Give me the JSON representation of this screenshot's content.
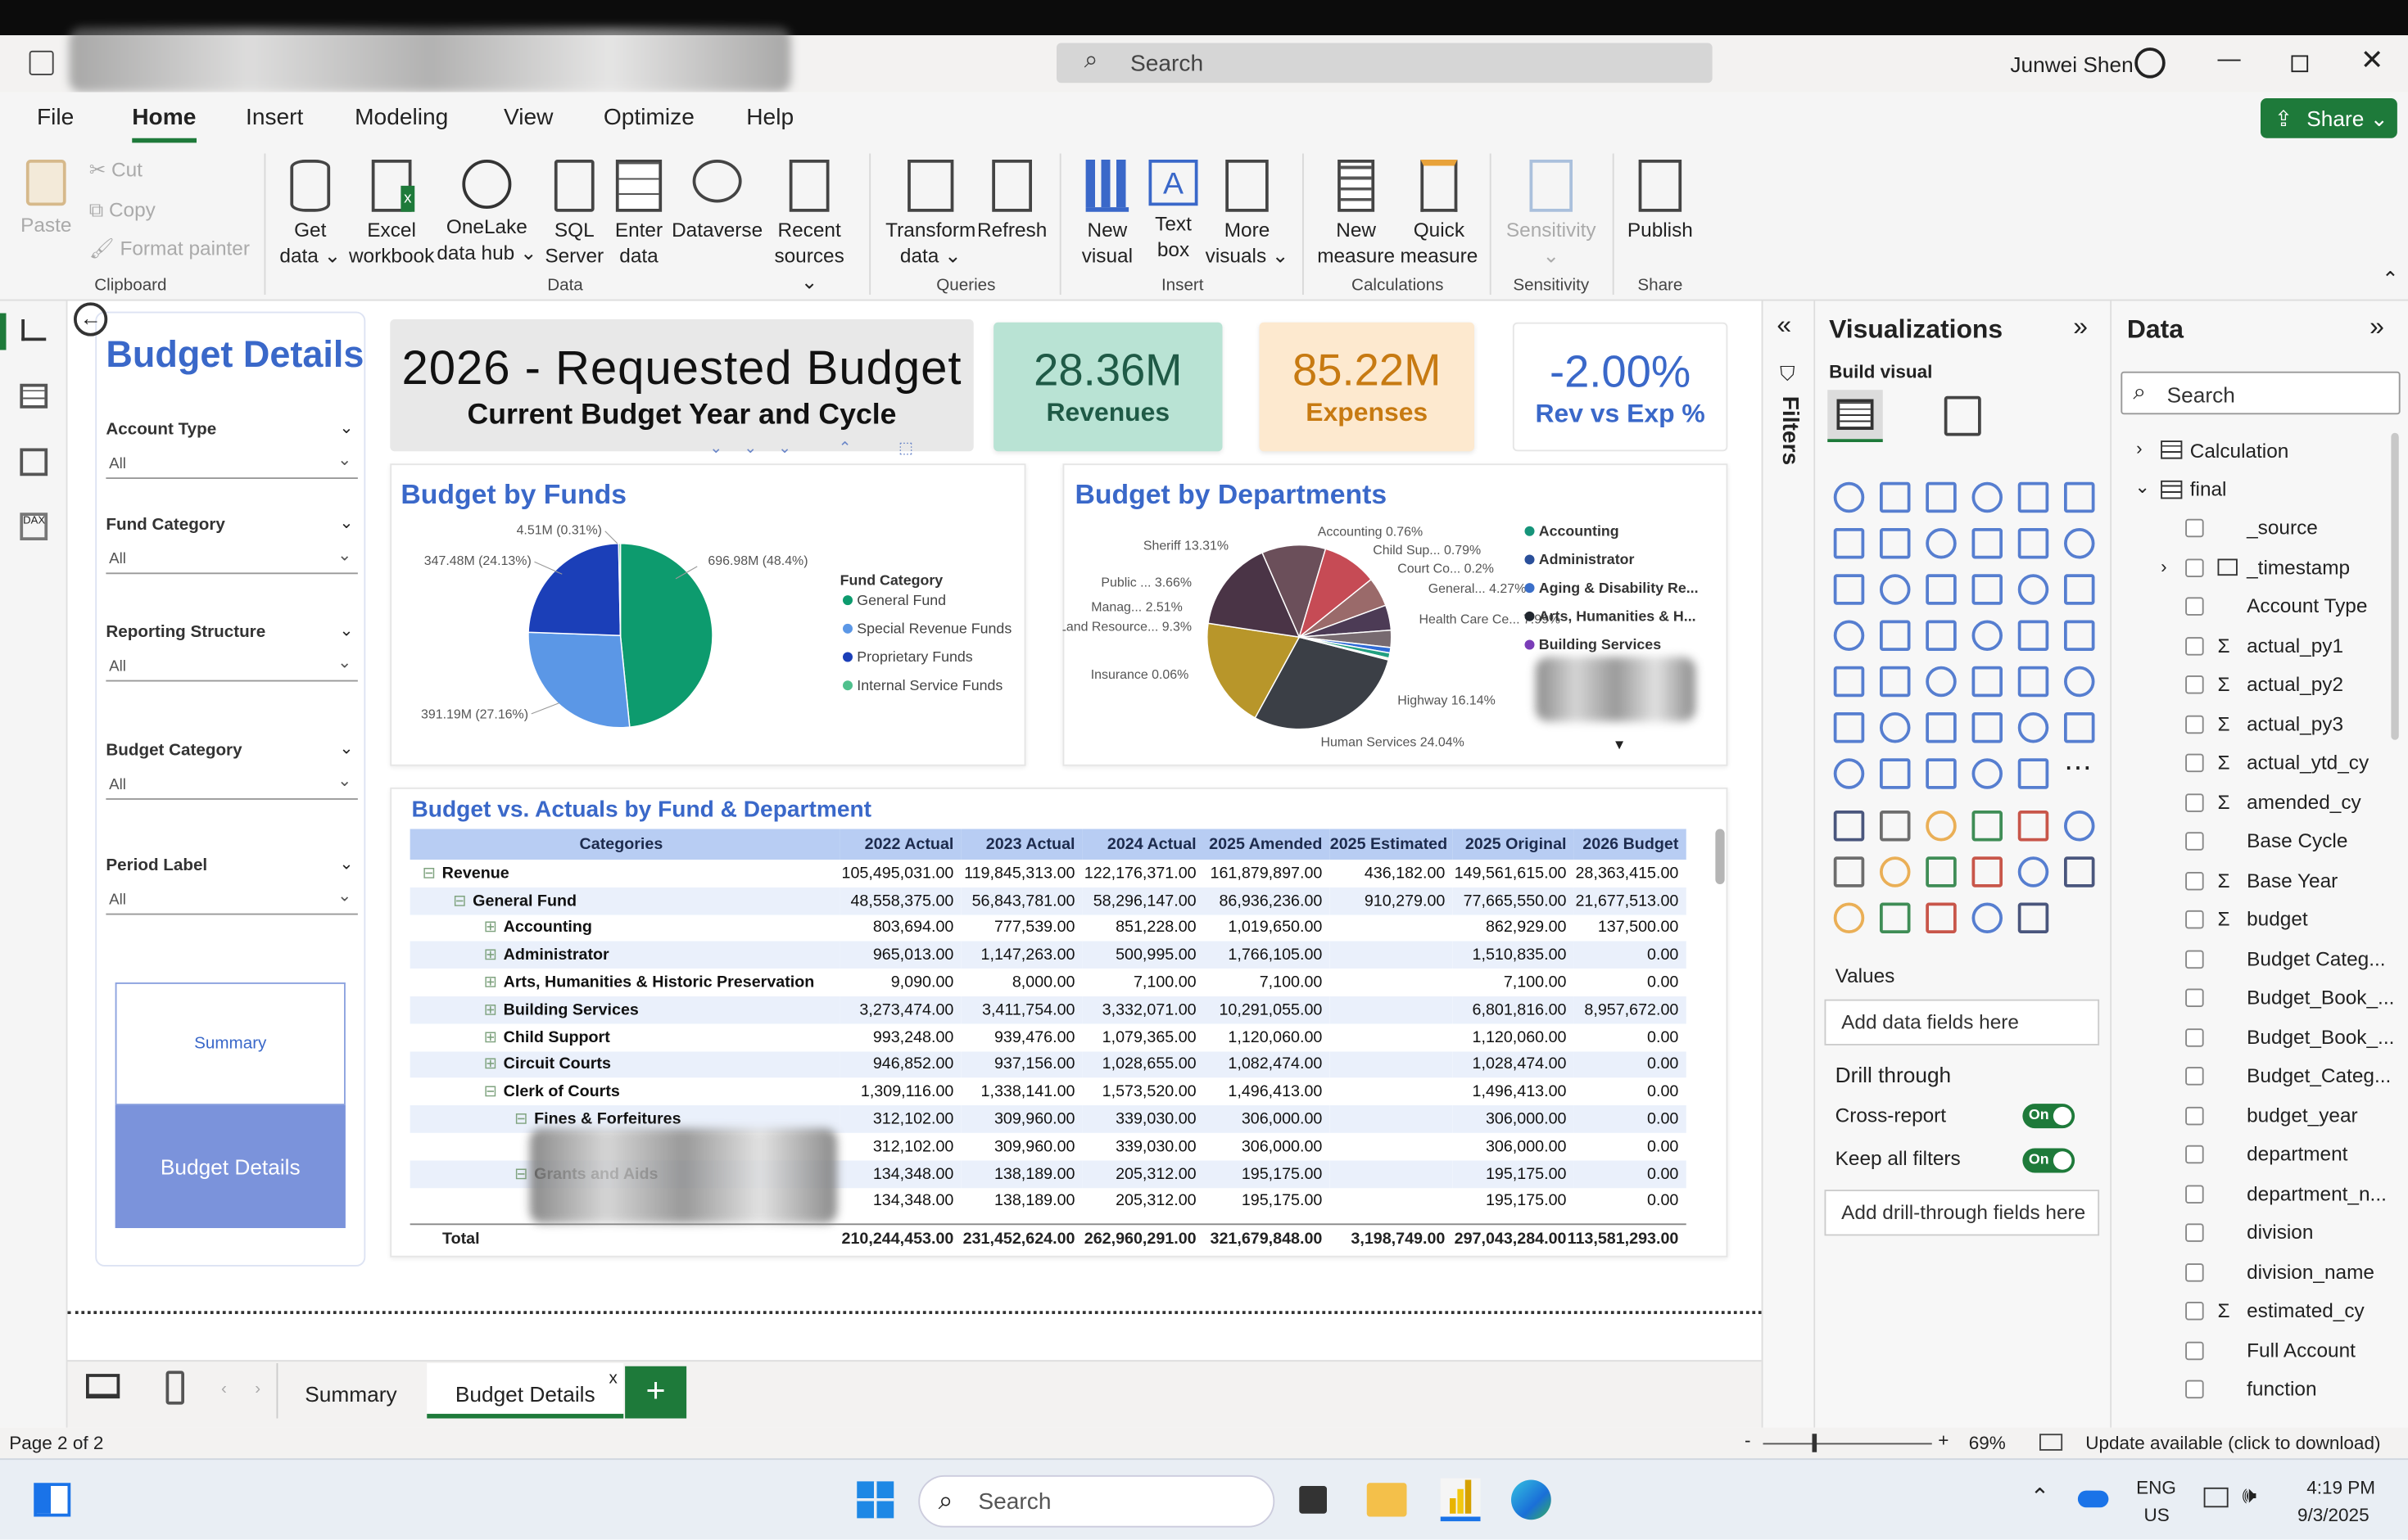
{
  "window": {
    "search_placeholder": "Search",
    "user_name": "Junwei Shen"
  },
  "menu": {
    "file": "File",
    "home": "Home",
    "insert": "Insert",
    "modeling": "Modeling",
    "view": "View",
    "optimize": "Optimize",
    "help": "Help",
    "share": "Share"
  },
  "ribbon": {
    "paste": "Paste",
    "cut": "Cut",
    "copy": "Copy",
    "format_painter": "Format painter",
    "clipboard": "Clipboard",
    "get_data_1": "Get",
    "get_data_2": "data ⌄",
    "excel_1": "Excel",
    "excel_2": "workbook",
    "onelake_1": "OneLake",
    "onelake_2": "data hub ⌄",
    "sql_1": "SQL",
    "sql_2": "Server",
    "enter_1": "Enter",
    "enter_2": "data",
    "dataverse": "Dataverse",
    "recent_1": "Recent",
    "recent_2": "sources ⌄",
    "data_group": "Data",
    "transform_1": "Transform",
    "transform_2": "data ⌄",
    "refresh": "Refresh",
    "queries_group": "Queries",
    "newvisual_1": "New",
    "newvisual_2": "visual",
    "textbox_1": "Text",
    "textbox_2": "box",
    "morevisuals_1": "More",
    "morevisuals_2": "visuals ⌄",
    "insert_group": "Insert",
    "newmeasure_1": "New",
    "newmeasure_2": "measure",
    "quickmeasure_1": "Quick",
    "quickmeasure_2": "measure",
    "calc_group": "Calculations",
    "sensitivity": "Sensitivity",
    "sensitivity_group": "Sensitivity",
    "publish": "Publish",
    "share_group": "Share"
  },
  "report": {
    "page_title": "Budget Details",
    "slicers": [
      {
        "label": "Account Type",
        "value": "All"
      },
      {
        "label": "Fund Category",
        "value": "All"
      },
      {
        "label": "Reporting Structure",
        "value": "All"
      },
      {
        "label": "Budget Category",
        "value": "All"
      },
      {
        "label": "Period Label",
        "value": "All"
      }
    ],
    "nav_summary": "Summary",
    "nav_details": "Budget Details",
    "header_title": "2026 - Requested Budget",
    "header_subtitle": "Current Budget Year and Cycle",
    "kpi_revenues_value": "28.36M",
    "kpi_revenues_label": "Revenues",
    "kpi_expenses_value": "85.22M",
    "kpi_expenses_label": "Expenses",
    "kpi_revexp_value": "-2.00%",
    "kpi_revexp_label": "Rev vs Exp %",
    "colors": {
      "title_blue": "#3a68c9",
      "revenue_bg": "#b9e3d4",
      "expense_bg": "#fde9cf",
      "expense_text": "#c77a12",
      "nav_active": "#7b93db"
    }
  },
  "chart_data": [
    {
      "type": "pie",
      "title": "Budget by Funds",
      "legend_title": "Fund Category",
      "labels": [
        "General Fund",
        "Special Revenue Funds",
        "Proprietary Funds",
        "Internal Service Funds"
      ],
      "values": [
        696.98,
        391.19,
        347.48,
        4.51
      ],
      "data_labels": [
        "696.98M (48.4%)",
        "391.19M (27.16%)",
        "347.48M (24.13%)",
        "4.51M (0.31%)"
      ],
      "colors": [
        "#0d9b6e",
        "#5b97e6",
        "#1b3fb8",
        "#4fc08d"
      ]
    },
    {
      "type": "pie",
      "title": "Budget by Departments",
      "legend": [
        "Accounting",
        "Administrator",
        "Aging & Disability Re...",
        "Arts, Humanities & H...",
        "Building Services"
      ],
      "legend_colors": [
        "#16947a",
        "#2a4f9a",
        "#3b6fc9",
        "#20262e",
        "#7a3db8"
      ],
      "data_labels": [
        "Human Services 24.04%",
        "Highway 16.14%",
        "Sheriff 13.31%",
        "Land Resource... 9.3%",
        "Health Care Ce... 7.99%",
        "General... 4.27%",
        "Public ... 3.66%",
        "Manag... 2.51%",
        "Child Sup... 0.79%",
        "Accounting 0.76%",
        "Court Co... 0.2%",
        "Insurance 0.06%"
      ],
      "labels": [
        "Human Services",
        "Highway",
        "Sheriff",
        "Land Resource...",
        "Health Care Ce...",
        "General...",
        "Public ...",
        "Manag...",
        "Child Sup...",
        "Accounting",
        "Court Co...",
        "Insurance"
      ],
      "values": [
        24.04,
        16.14,
        13.31,
        9.3,
        7.99,
        4.27,
        3.66,
        2.51,
        0.79,
        0.76,
        0.2,
        0.06
      ],
      "colors": [
        "#3b3f46",
        "#b8962a",
        "#4a3446",
        "#6b4f5a",
        "#c64b55",
        "#9a6a6a",
        "#4c3b55",
        "#776a70",
        "#2f6bd6",
        "#22a080",
        "#f2a33b",
        "#9bb6d8"
      ]
    }
  ],
  "matrix": {
    "title": "Budget vs. Actuals by Fund & Department",
    "headers": [
      "Categories",
      "2022 Actual",
      "2023 Actual",
      "2024 Actual",
      "2025 Amended",
      "2025 Estimated",
      "2025 Original",
      "2026 Budget"
    ],
    "rows": [
      {
        "label": "Revenue",
        "level": 0,
        "icon": "⊟",
        "vals": [
          "105,495,031.00",
          "119,845,313.00",
          "122,176,371.00",
          "161,879,897.00",
          "436,182.00",
          "149,561,615.00",
          "28,363,415.00"
        ]
      },
      {
        "label": "General Fund",
        "level": 1,
        "icon": "⊟",
        "vals": [
          "48,558,375.00",
          "56,843,781.00",
          "58,296,147.00",
          "86,936,236.00",
          "910,279.00",
          "77,665,550.00",
          "21,677,513.00"
        ]
      },
      {
        "label": "Accounting",
        "level": 2,
        "icon": "⊞",
        "vals": [
          "803,694.00",
          "777,539.00",
          "851,228.00",
          "1,019,650.00",
          "",
          "862,929.00",
          "137,500.00"
        ]
      },
      {
        "label": "Administrator",
        "level": 2,
        "icon": "⊞",
        "vals": [
          "965,013.00",
          "1,147,263.00",
          "500,995.00",
          "1,766,105.00",
          "",
          "1,510,835.00",
          "0.00"
        ]
      },
      {
        "label": "Arts, Humanities & Historic Preservation",
        "level": 2,
        "icon": "⊞",
        "vals": [
          "9,090.00",
          "8,000.00",
          "7,100.00",
          "7,100.00",
          "",
          "7,100.00",
          "0.00"
        ]
      },
      {
        "label": "Building Services",
        "level": 2,
        "icon": "⊞",
        "vals": [
          "3,273,474.00",
          "3,411,754.00",
          "3,332,071.00",
          "10,291,055.00",
          "",
          "6,801,816.00",
          "8,957,672.00"
        ]
      },
      {
        "label": "Child Support",
        "level": 2,
        "icon": "⊞",
        "vals": [
          "993,248.00",
          "939,476.00",
          "1,079,365.00",
          "1,120,060.00",
          "",
          "1,120,060.00",
          "0.00"
        ]
      },
      {
        "label": "Circuit Courts",
        "level": 2,
        "icon": "⊞",
        "vals": [
          "946,852.00",
          "937,156.00",
          "1,028,655.00",
          "1,082,474.00",
          "",
          "1,028,474.00",
          "0.00"
        ]
      },
      {
        "label": "Clerk of Courts",
        "level": 2,
        "icon": "⊟",
        "vals": [
          "1,309,116.00",
          "1,338,141.00",
          "1,573,520.00",
          "1,496,413.00",
          "",
          "1,496,413.00",
          "0.00"
        ]
      },
      {
        "label": "Fines & Forfeitures",
        "level": 3,
        "icon": "⊟",
        "vals": [
          "312,102.00",
          "309,960.00",
          "339,030.00",
          "306,000.00",
          "",
          "306,000.00",
          "0.00"
        ]
      },
      {
        "label": "",
        "level": 4,
        "icon": "",
        "vals": [
          "312,102.00",
          "309,960.00",
          "339,030.00",
          "306,000.00",
          "",
          "306,000.00",
          "0.00"
        ]
      },
      {
        "label": "Grants and Aids",
        "level": 3,
        "icon": "⊟",
        "vals": [
          "134,348.00",
          "138,189.00",
          "205,312.00",
          "195,175.00",
          "",
          "195,175.00",
          "0.00"
        ]
      },
      {
        "label": "",
        "level": 4,
        "icon": "",
        "vals": [
          "134,348.00",
          "138,189.00",
          "205,312.00",
          "195,175.00",
          "",
          "195,175.00",
          "0.00"
        ]
      }
    ],
    "total": {
      "label": "Total",
      "vals": [
        "210,244,453.00",
        "231,452,624.00",
        "262,960,291.00",
        "321,679,848.00",
        "3,198,749.00",
        "297,043,284.00",
        "113,581,293.00"
      ]
    }
  },
  "tabs": {
    "summary": "Summary",
    "details": "Budget Details",
    "close": "x",
    "add": "+"
  },
  "status": {
    "page": "Page 2 of 2",
    "zoom": "69%",
    "update": "Update available (click to download)"
  },
  "panes": {
    "filters": "Filters",
    "viz_title": "Visualizations",
    "build_visual": "Build visual",
    "values_label": "Values",
    "values_placeholder": "Add data fields here",
    "drill_through": "Drill through",
    "cross_report": "Cross-report",
    "keep_filters": "Keep all filters",
    "toggle_on": "On",
    "drill_placeholder": "Add drill-through fields here",
    "data_title": "Data",
    "data_search": "Search",
    "tables": [
      "Calculation",
      "final"
    ],
    "fields": [
      "_source",
      "_timestamp",
      "Account Type",
      "actual_py1",
      "actual_py2",
      "actual_py3",
      "actual_ytd_cy",
      "amended_cy",
      "Base Cycle",
      "Base Year",
      "budget",
      "Budget Categ...",
      "Budget_Book_...",
      "Budget_Book_...",
      "Budget_Categ...",
      "budget_year",
      "department",
      "department_n...",
      "division",
      "division_name",
      "estimated_cy",
      "Full Account",
      "function"
    ],
    "sigma_fields": [
      false,
      false,
      false,
      true,
      true,
      true,
      true,
      true,
      false,
      true,
      true,
      false,
      false,
      false,
      false,
      false,
      false,
      false,
      false,
      false,
      true,
      false,
      false
    ]
  },
  "taskbar": {
    "search": "Search",
    "lang1": "ENG",
    "lang2": "US",
    "time": "4:19 PM",
    "date": "9/3/2025"
  }
}
